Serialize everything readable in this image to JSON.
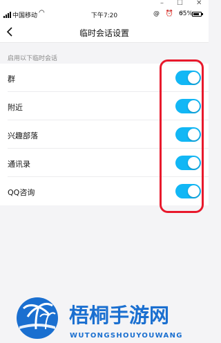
{
  "window": {
    "minimize": "–",
    "maximize": "☐",
    "close": "✕"
  },
  "status_bar": {
    "carrier": "中国移动",
    "time": "下午7:20",
    "icons": "@ ⏰ ⚡",
    "battery": "65%"
  },
  "nav": {
    "title": "临时会话设置"
  },
  "section": {
    "header": "启用以下临时会话",
    "items": [
      {
        "label": "群",
        "enabled": true
      },
      {
        "label": "附近",
        "enabled": true
      },
      {
        "label": "兴趣部落",
        "enabled": true
      },
      {
        "label": "通讯录",
        "enabled": true
      },
      {
        "label": "QQ咨询",
        "enabled": true
      }
    ]
  },
  "watermark": {
    "name": "梧桐手游网",
    "subtitle": "WUTONGSHOUYOUWANG"
  },
  "colors": {
    "toggle_on": "#12b7f5",
    "highlight": "#e8192c",
    "logo_primary": "#1a6fd0"
  }
}
